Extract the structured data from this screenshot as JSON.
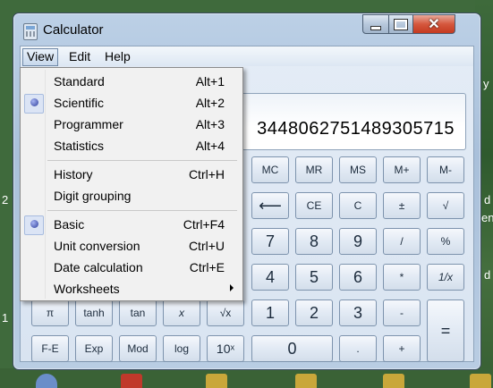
{
  "window": {
    "title": "Calculator"
  },
  "menubar": {
    "view": "View",
    "edit": "Edit",
    "help": "Help"
  },
  "display": {
    "value": "3448062751489305715"
  },
  "memory_row": [
    "MC",
    "MR",
    "MS",
    "M+",
    "M-"
  ],
  "edit_row": {
    "backspace": "⟵",
    "ce": "CE",
    "c": "C",
    "negate": "±",
    "sqrt": "√"
  },
  "digits": {
    "seven": "7",
    "eight": "8",
    "nine": "9",
    "divide": "/",
    "percent": "%",
    "four": "4",
    "five": "5",
    "six": "6",
    "multiply": "*",
    "reciprocal": "1/x",
    "one": "1",
    "two": "2",
    "three": "3",
    "minus": "-",
    "equals": "=",
    "zero": "0",
    "decimal": ".",
    "plus": "+"
  },
  "scientific_partial": {
    "pi": "π",
    "tanh": "tanh",
    "tan": "tan",
    "x": "x",
    "root": "√x"
  },
  "scientific_bottom": {
    "fe": "F-E",
    "exp": "Exp",
    "mod": "Mod",
    "log": "log",
    "ten_x": "10ˣ"
  },
  "view_menu": {
    "items": [
      {
        "label": "Standard",
        "shortcut": "Alt+1",
        "checked": false
      },
      {
        "label": "Scientific",
        "shortcut": "Alt+2",
        "checked": true
      },
      {
        "label": "Programmer",
        "shortcut": "Alt+3",
        "checked": false
      },
      {
        "label": "Statistics",
        "shortcut": "Alt+4",
        "checked": false
      },
      {
        "label": "History",
        "shortcut": "Ctrl+H",
        "checked": false
      },
      {
        "label": "Digit grouping",
        "shortcut": "",
        "checked": false
      },
      {
        "label": "Basic",
        "shortcut": "Ctrl+F4",
        "checked": true
      },
      {
        "label": "Unit conversion",
        "shortcut": "Ctrl+U",
        "checked": false
      },
      {
        "label": "Date calculation",
        "shortcut": "Ctrl+E",
        "checked": false
      },
      {
        "label": "Worksheets",
        "shortcut": "",
        "checked": false,
        "submenu": true
      }
    ]
  },
  "desktop": {
    "right_chars": [
      "y",
      "d",
      "d",
      "en"
    ],
    "left_chars": [
      "2",
      "1"
    ]
  },
  "colors": {
    "desktop": "#3f6a3c",
    "frame": "#b9cde3",
    "close": "#c43a1f",
    "radio": "#2f3f9c"
  }
}
